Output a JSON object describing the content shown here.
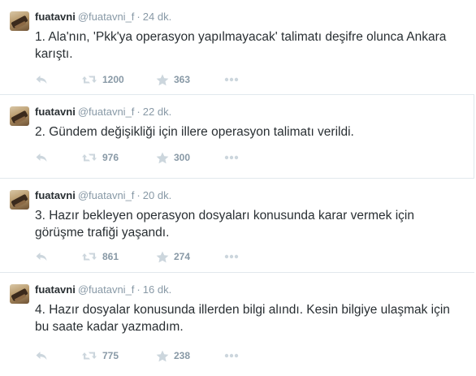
{
  "tweets": [
    {
      "name": "fuatavni",
      "handle": "@fuatavni_f",
      "separator": "·",
      "time": "24 dk.",
      "text": "1. Ala'nın, 'Pkk'ya operasyon yapılmayacak' talimatı deşifre olunca Ankara karıştı.",
      "retweets": "1200",
      "favorites": "363"
    },
    {
      "name": "fuatavni",
      "handle": "@fuatavni_f",
      "separator": "·",
      "time": "22 dk.",
      "text": "2. Gündem değişikliği için illere operasyon talimatı verildi.",
      "retweets": "976",
      "favorites": "300"
    },
    {
      "name": "fuatavni",
      "handle": "@fuatavni_f",
      "separator": "·",
      "time": "20 dk.",
      "text": "3. Hazır bekleyen operasyon dosyaları konusunda karar vermek için görüşme trafiği yaşandı.",
      "retweets": "861",
      "favorites": "274"
    },
    {
      "name": "fuatavni",
      "handle": "@fuatavni_f",
      "separator": "·",
      "time": "16 dk.",
      "text": "4. Hazır dosyalar konusunda illerden bilgi alındı. Kesin bilgiye ulaşmak için bu saate kadar yazmadım.",
      "retweets": "775",
      "favorites": "238"
    }
  ],
  "icons": {
    "reply": "reply-icon",
    "retweet": "retweet-icon",
    "favorite": "star-icon",
    "more": "more-dots-icon"
  },
  "colors": {
    "text": "#292f33",
    "meta": "#8899a6",
    "icon": "#ccd6dd",
    "divider": "#e1e8ed"
  }
}
